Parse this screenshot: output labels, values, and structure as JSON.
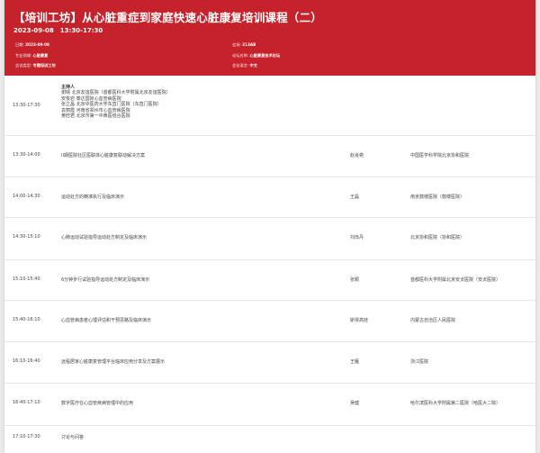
{
  "header": {
    "title": "【培训工坊】从心脏重症到家庭快速心脏康复培训课程（二）",
    "datetime": "2023-09-08　13:30-17:30",
    "date_label": "日期:",
    "date_value": "2023-09-08",
    "room_label": "会场:",
    "room_value": "213AB",
    "field_label": "专业领域:",
    "field_value": "心脏康复",
    "forum_label": "论坛名称:",
    "forum_value": "心脏康复技术论坛",
    "type_label": "会议类型:",
    "type_value": "专题培训工坊",
    "lang_label": "会议语言:",
    "lang_value": "中文"
  },
  "chair_block": {
    "time": "13:30-17:30",
    "title": "主持人",
    "lines": [
      "谢晴 北京友谊医院（首都医科大学附属北京友谊医院）",
      "安俊岩 泰达国际心血管病医院",
      "张立晶 北京中医药大学东直门医院（东直门医院）",
      "袁丽霞 河南省郑州市心血管病医院",
      "黄旺君 北京市第一中西医结合医院"
    ]
  },
  "schedule": [
    {
      "time": "13:30-14:00",
      "topic": "II期医院社区医联体心脏康复联动解决方案",
      "speaker": "赵肖奕",
      "org": "中国医学科学院北京协和医院"
    },
    {
      "time": "14:00-14:30",
      "topic": "运动处方的精准执行及临床演示",
      "speaker": "王磊",
      "org": "南京鼓楼医院（鼓楼医院）"
    },
    {
      "time": "14:30-15:10",
      "topic": "心肺运动试验指导运动处方制定及临床演示",
      "speaker": "刘烁丹",
      "org": "北京协和医院（协和医院）"
    },
    {
      "time": "15:10-15:40",
      "topic": "6分钟步行试验指导运动处方制定及临床演示",
      "speaker": "张颖",
      "org": "首都医科大学附属北京安贞医院（安贞医院）"
    },
    {
      "time": "15:40-16:10",
      "topic": "心血管病患者心理评估和干预思路及临床演示",
      "speaker": "斯琴高娃",
      "org": "内蒙古自治区人民医院"
    },
    {
      "time": "16:10-16:40",
      "topic": "远程居家心脏康复管理平台临床应用分享及方案展示",
      "speaker": "王雁",
      "org": "浙江医院"
    },
    {
      "time": "16:40-17:10",
      "topic": "数字医疗在心血管疾病管理中的应用",
      "speaker": "吴健",
      "org": "哈尔滨医科大学附属第二医院（哈医大二院）"
    },
    {
      "time": "17:10-17:30",
      "topic": "讨论与问答",
      "speaker": "",
      "org": ""
    }
  ]
}
